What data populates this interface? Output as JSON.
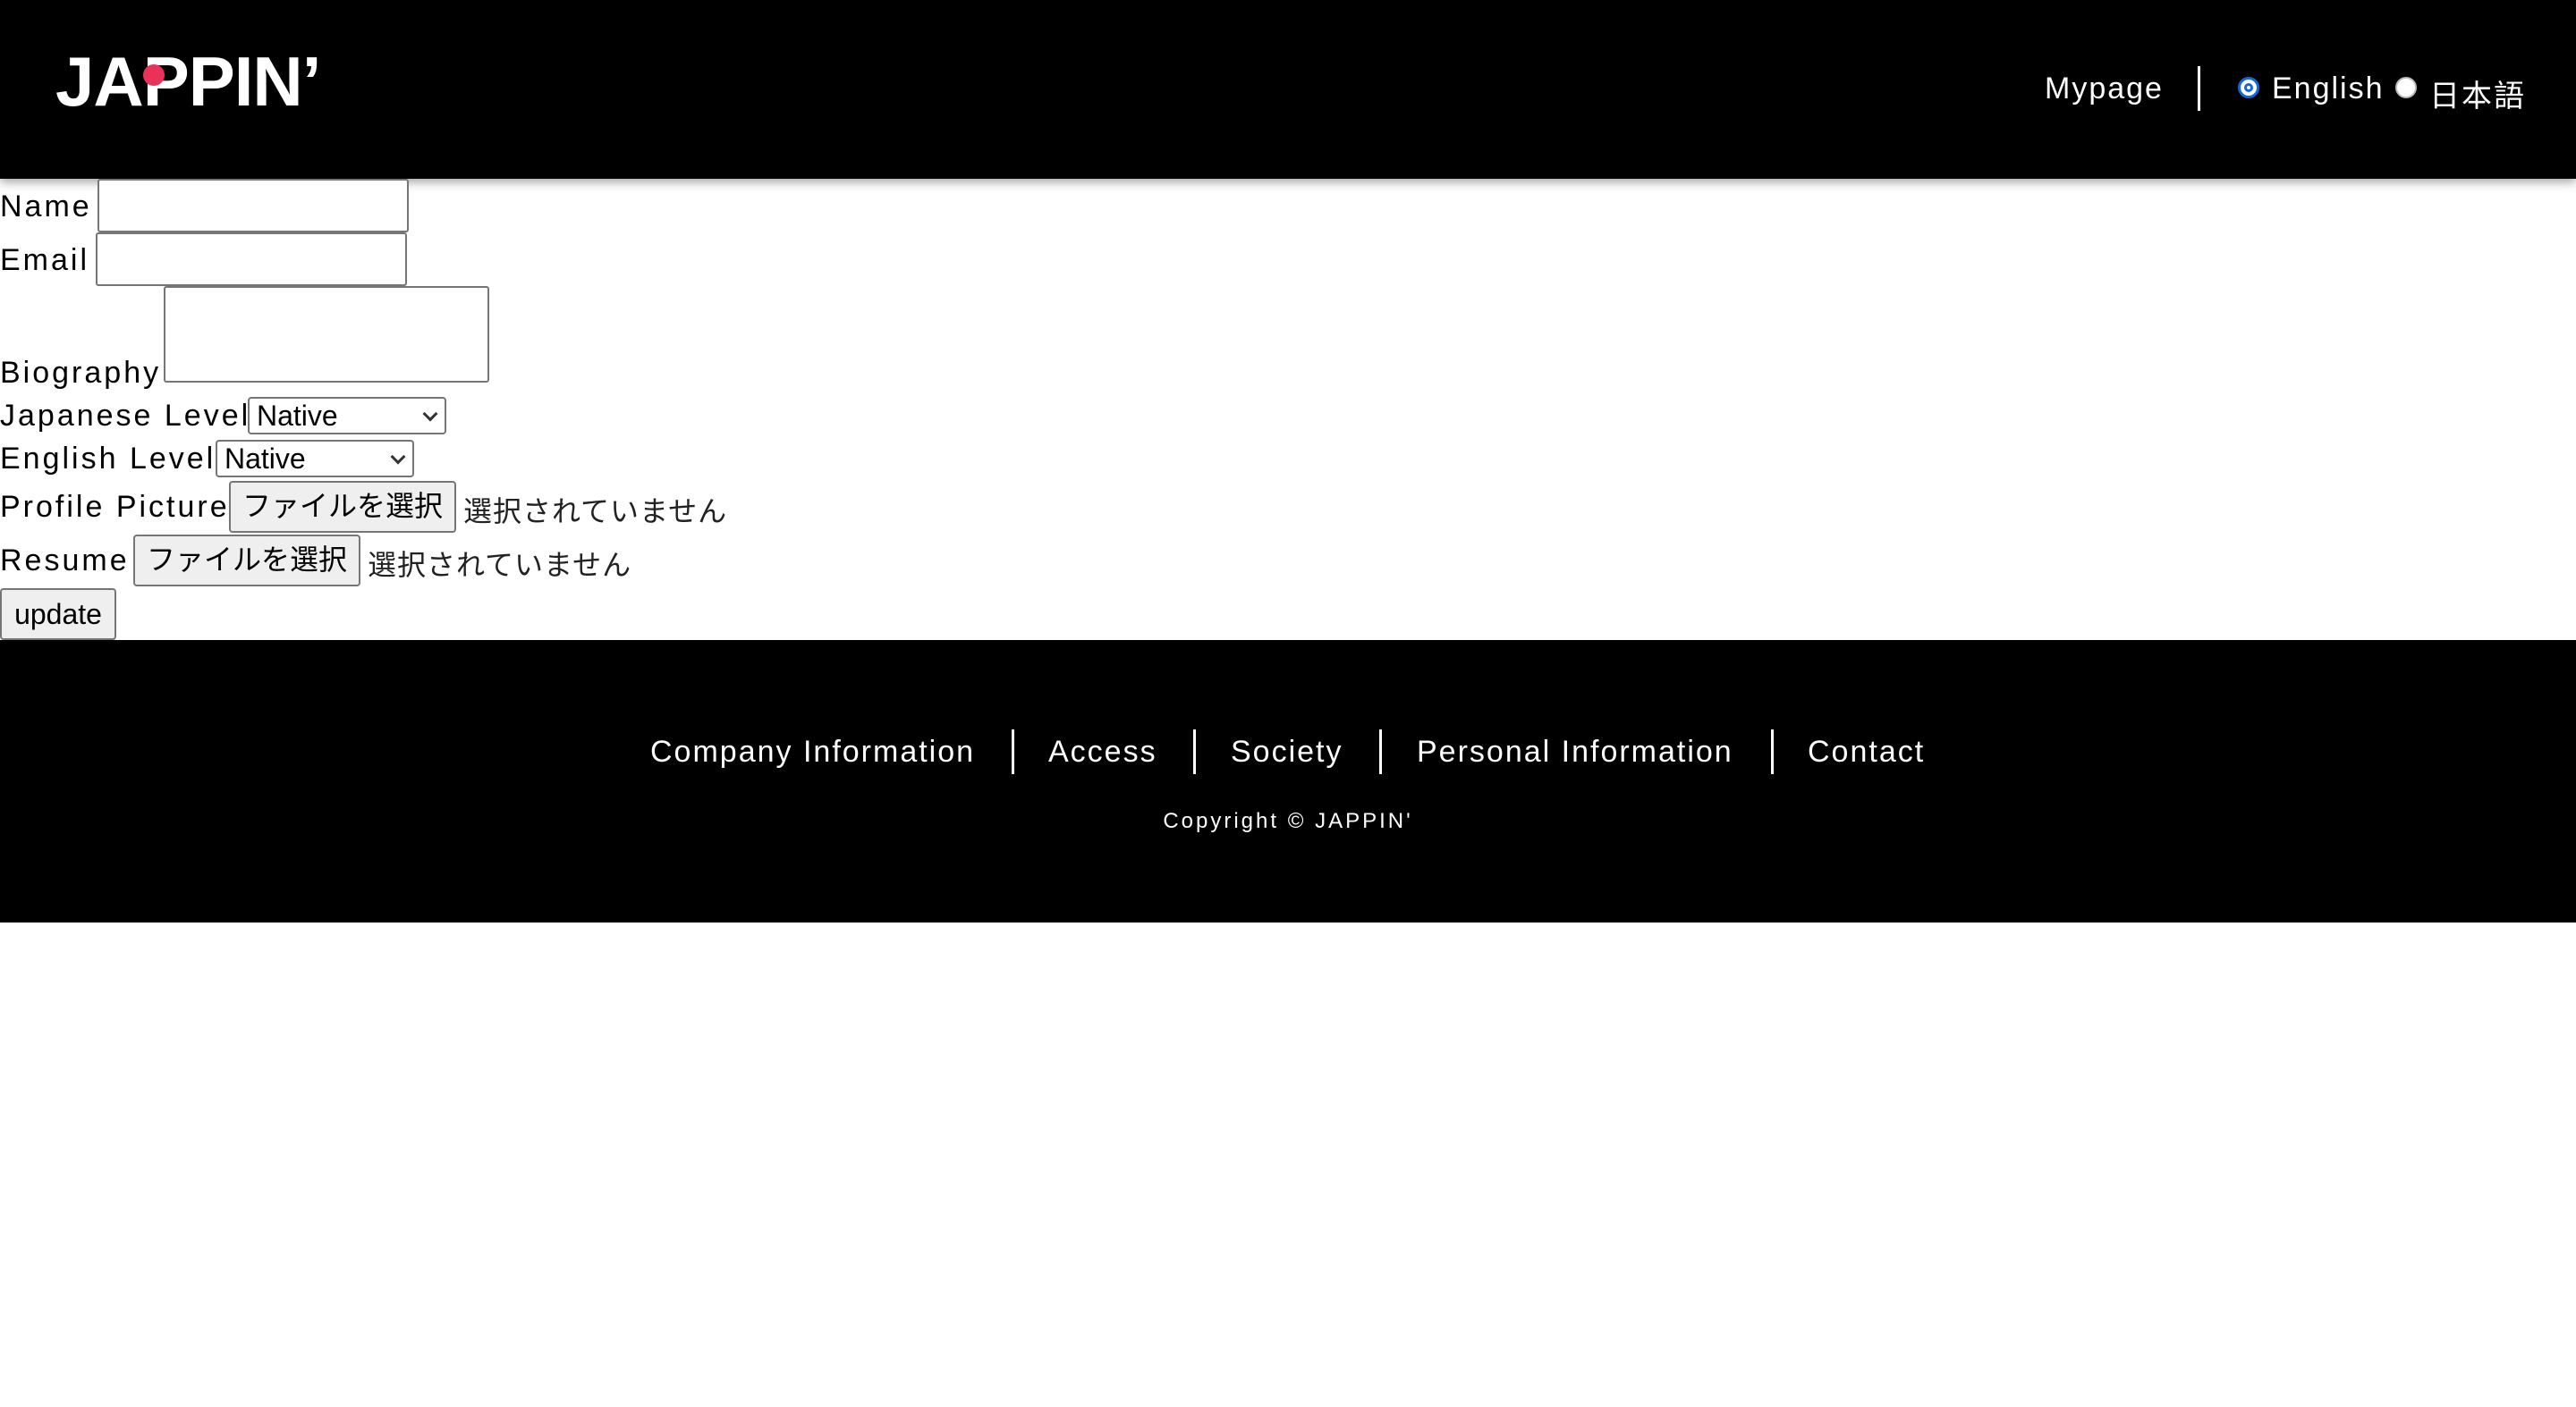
{
  "header": {
    "logo_text": "JAPPIN’",
    "mypage_label": "Mypage",
    "languages": [
      {
        "label": "English",
        "selected": true
      },
      {
        "label": "日本語",
        "selected": false
      }
    ]
  },
  "form": {
    "name_label": "Name",
    "name_value": "",
    "email_label": "Email",
    "email_value": "",
    "biography_label": "Biography",
    "biography_value": "",
    "japanese_level_label": "Japanese Level",
    "japanese_level_value": "Native",
    "english_level_label": "English Level",
    "english_level_value": "Native",
    "profile_picture_label": "Profile Picture",
    "resume_label": "Resume",
    "file_button_label": "ファイルを選択",
    "no_file_text": "選択されていません",
    "update_label": "update"
  },
  "footer": {
    "links": [
      "Company Information",
      "Access",
      "Society",
      "Personal Information",
      "Contact"
    ],
    "copyright": "Copyright © JAPPIN'"
  },
  "colors": {
    "header_bg": "#000000",
    "footer_bg": "#000000",
    "logo_accent": "#e8325a",
    "radio_accent": "#1565e0"
  }
}
